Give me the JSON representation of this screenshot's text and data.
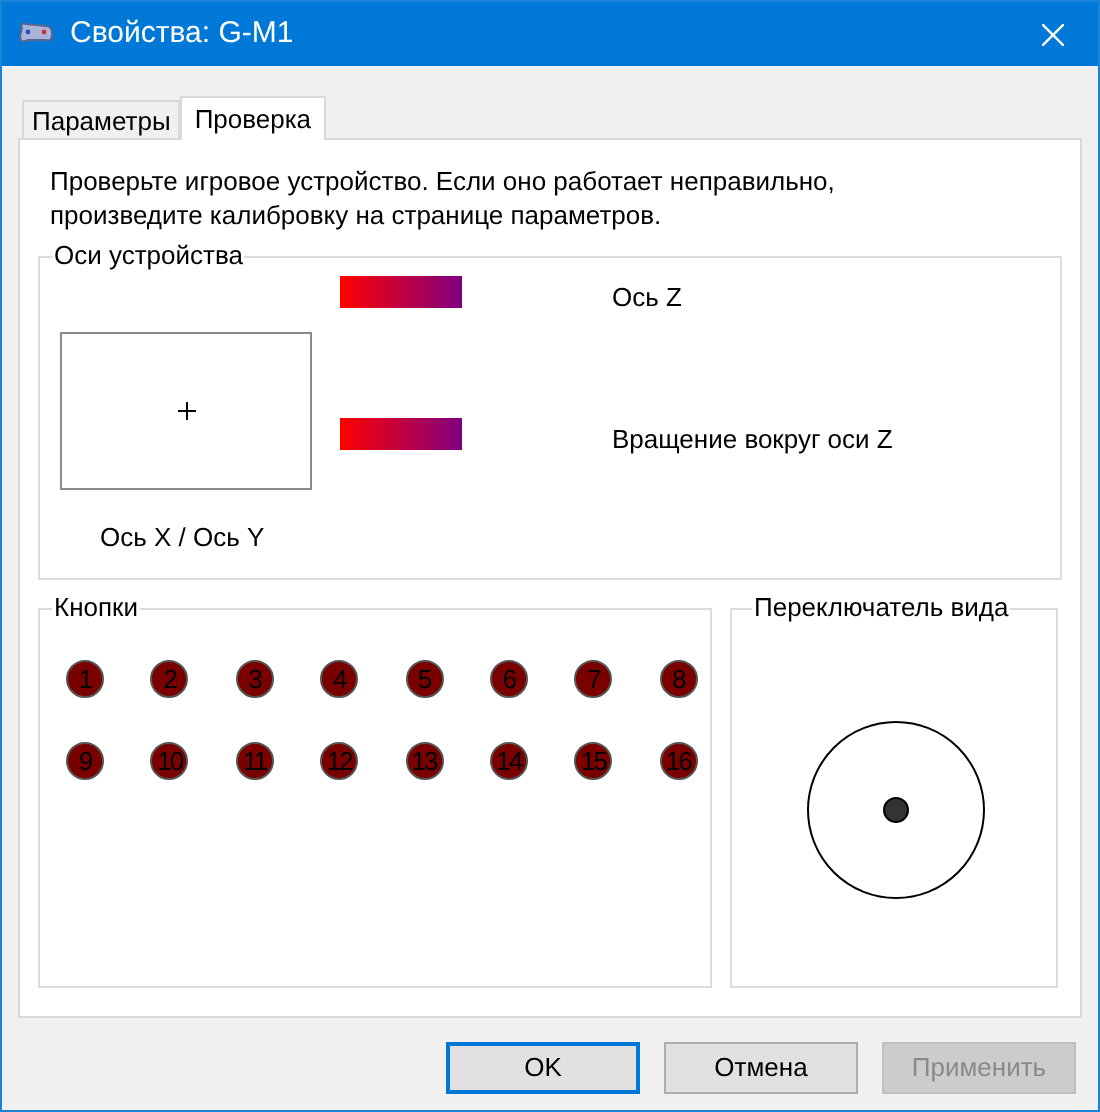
{
  "window": {
    "title": "Свойства: G-M1"
  },
  "tabs": [
    {
      "label": "Параметры",
      "selected": false
    },
    {
      "label": "Проверка",
      "selected": true
    }
  ],
  "intro": "Проверьте игровое устройство. Если оно работает неправильно, произведите калибровку на странице параметров.",
  "axes": {
    "title": "Оси устройства",
    "xy_label": "Ось X / Ось Y",
    "bars": [
      {
        "label": "Ось Z"
      },
      {
        "label": "Вращение вокруг оси Z"
      }
    ]
  },
  "buttons_group": {
    "title": "Кнопки",
    "buttons": [
      {
        "label": "1",
        "pressed": false
      },
      {
        "label": "2",
        "pressed": false
      },
      {
        "label": "3",
        "pressed": false
      },
      {
        "label": "4",
        "pressed": false
      },
      {
        "label": "5",
        "pressed": false
      },
      {
        "label": "6",
        "pressed": false
      },
      {
        "label": "7",
        "pressed": false
      },
      {
        "label": "8",
        "pressed": false
      },
      {
        "label": "9",
        "pressed": false
      },
      {
        "label": "10",
        "pressed": false
      },
      {
        "label": "11",
        "pressed": false
      },
      {
        "label": "12",
        "pressed": false
      },
      {
        "label": "13",
        "pressed": false
      },
      {
        "label": "14",
        "pressed": false
      },
      {
        "label": "15",
        "pressed": false
      },
      {
        "label": "16",
        "pressed": false
      }
    ]
  },
  "pov": {
    "title": "Переключатель вида"
  },
  "dialog_buttons": [
    {
      "label": "OK",
      "default": true,
      "disabled": false
    },
    {
      "label": "Отмена",
      "default": false,
      "disabled": false
    },
    {
      "label": "Применить",
      "default": false,
      "disabled": true
    }
  ]
}
